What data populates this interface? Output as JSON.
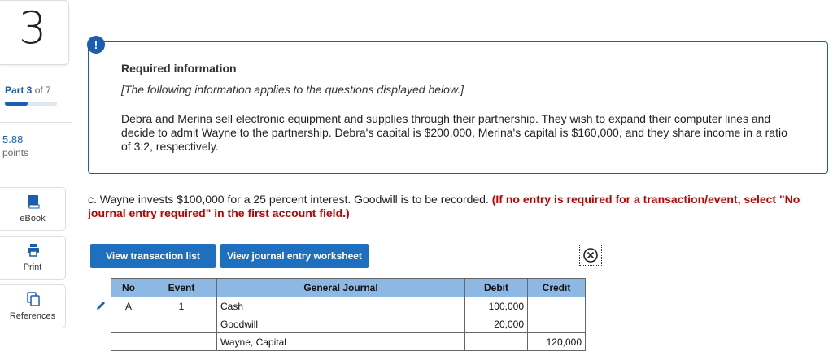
{
  "sidebar": {
    "question_number": "3",
    "part_label": "Part 3",
    "part_of": "of 7",
    "progress_fraction": 0.43,
    "points_value": "5.88",
    "points_label": "points",
    "tools": [
      {
        "label": "eBook",
        "icon": "book-icon"
      },
      {
        "label": "Print",
        "icon": "printer-icon"
      },
      {
        "label": "References",
        "icon": "references-icon"
      }
    ]
  },
  "info": {
    "alert_symbol": "!",
    "title": "Required information",
    "italic": "[The following information applies to the questions displayed below.]",
    "body": "Debra and Merina sell electronic equipment and supplies through their partnership. They wish to expand their computer lines and decide to admit Wayne to the partnership. Debra's capital is $200,000, Merina's capital is $160,000, and they share income in a ratio of 3:2, respectively."
  },
  "question": {
    "text": "c. Wayne invests $100,000 for a 25 percent interest. Goodwill is to be recorded.",
    "instruction": "(If no entry is required for a transaction/event, select \"No journal entry required\" in the first account field.)"
  },
  "buttons": {
    "view_transaction_list": "View transaction list",
    "view_journal_worksheet": "View journal entry worksheet"
  },
  "journal": {
    "headers": {
      "no": "No",
      "event": "Event",
      "general_journal": "General Journal",
      "debit": "Debit",
      "credit": "Credit"
    },
    "rows": [
      {
        "no": "A",
        "event": "1",
        "account": "Cash",
        "debit": "100,000",
        "credit": ""
      },
      {
        "no": "",
        "event": "",
        "account": "Goodwill",
        "debit": "20,000",
        "credit": ""
      },
      {
        "no": "",
        "event": "",
        "account": "Wayne, Capital",
        "debit": "",
        "credit": "120,000"
      }
    ]
  },
  "colors": {
    "accent": "#1a5eb0",
    "button": "#1e6fc0",
    "table_header": "#8db8e4",
    "required": "#c00000"
  }
}
